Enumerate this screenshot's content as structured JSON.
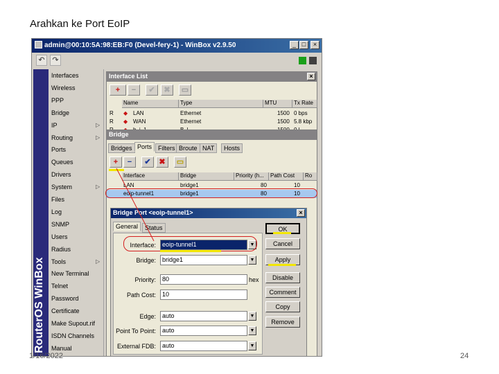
{
  "slide": {
    "title": "Arahkan ke Port EoIP",
    "date": "1/16/2022",
    "page": "24"
  },
  "winbox": {
    "title": "admin@00:10:5A:98:EB:F0 (Devel-fery-1) - WinBox v2.9.50",
    "controls": {
      "minimize": "_",
      "maximize": "□",
      "close": "×"
    },
    "toolbar": {
      "undo_icon": "↶",
      "redo_icon": "↷"
    },
    "brand": "RouterOS WinBox",
    "menu": [
      {
        "label": "Interfaces"
      },
      {
        "label": "Wireless"
      },
      {
        "label": "PPP"
      },
      {
        "label": "Bridge"
      },
      {
        "label": "IP",
        "arrow": "▷"
      },
      {
        "label": "Routing",
        "arrow": "▷"
      },
      {
        "label": "Ports"
      },
      {
        "label": "Queues"
      },
      {
        "label": "Drivers"
      },
      {
        "label": "System",
        "arrow": "▷"
      },
      {
        "label": "Files"
      },
      {
        "label": "Log"
      },
      {
        "label": "SNMP"
      },
      {
        "label": "Users"
      },
      {
        "label": "Radius"
      },
      {
        "label": "Tools",
        "arrow": "▷"
      },
      {
        "label": "New Terminal"
      },
      {
        "label": "Telnet"
      },
      {
        "label": "Password"
      },
      {
        "label": "Certificate"
      },
      {
        "label": "Make Supout.rif"
      },
      {
        "label": "ISDN Channels"
      },
      {
        "label": "Manual"
      }
    ]
  },
  "interface_list": {
    "title": "Interface List",
    "buttons": {
      "add": "+",
      "add_dropdown": "▾",
      "remove": "−",
      "enable": "✔",
      "disable": "✖",
      "comment": "▭"
    },
    "columns": [
      "Name",
      "Type",
      "MTU",
      "Tx Rate"
    ],
    "rows": [
      {
        "flag": "R",
        "name": "LAN",
        "type": "Ethernet",
        "mtu": "1500",
        "tx": "0 bps"
      },
      {
        "flag": "R",
        "name": "WAN",
        "type": "Ethernet",
        "mtu": "1500",
        "tx": "5.8 kbp"
      },
      {
        "flag": "R",
        "name": "b..i..1",
        "type": "B..l..",
        "mtu": "1500",
        "tx": "0 l.."
      }
    ]
  },
  "bridge": {
    "title": "Bridge",
    "tabs": [
      "Bridges",
      "Ports",
      "Filters",
      "Broute",
      "NAT",
      "Hosts"
    ],
    "buttons": {
      "add": "+",
      "remove": "−",
      "enable": "✔",
      "disable": "✖",
      "comment": "▭"
    },
    "columns": [
      "Interface",
      "Bridge",
      "Priority (h...",
      "Path Cost",
      "Ro"
    ],
    "rows": [
      {
        "interface": "LAN",
        "bridge": "bridge1",
        "priority": "80",
        "path_cost": "10"
      },
      {
        "interface": "eoip-tunnel1",
        "bridge": "bridge1",
        "priority": "80",
        "path_cost": "10"
      }
    ]
  },
  "bridge_port": {
    "title": "Bridge Port <eoip-tunnel1>",
    "tabs": [
      "General",
      "Status"
    ],
    "fields": {
      "interface": {
        "label": "Interface:",
        "value": "eoip-tunnel1"
      },
      "bridge": {
        "label": "Bridge:",
        "value": "bridge1"
      },
      "priority": {
        "label": "Priority:",
        "value": "80",
        "suffix": "hex"
      },
      "path_cost": {
        "label": "Path Cost:",
        "value": "10"
      },
      "edge": {
        "label": "Edge:",
        "value": "auto"
      },
      "point_to_point": {
        "label": "Point To Point:",
        "value": "auto"
      },
      "external_fdb": {
        "label": "External FDB:",
        "value": "auto"
      }
    },
    "actions": [
      "OK",
      "Cancel",
      "Apply",
      "Disable",
      "Comment",
      "Copy",
      "Remove"
    ]
  },
  "colors": {
    "highlight": "#f2e600",
    "annotation": "#d42020",
    "title_active": "#0a246a",
    "title_inactive": "#848284"
  }
}
